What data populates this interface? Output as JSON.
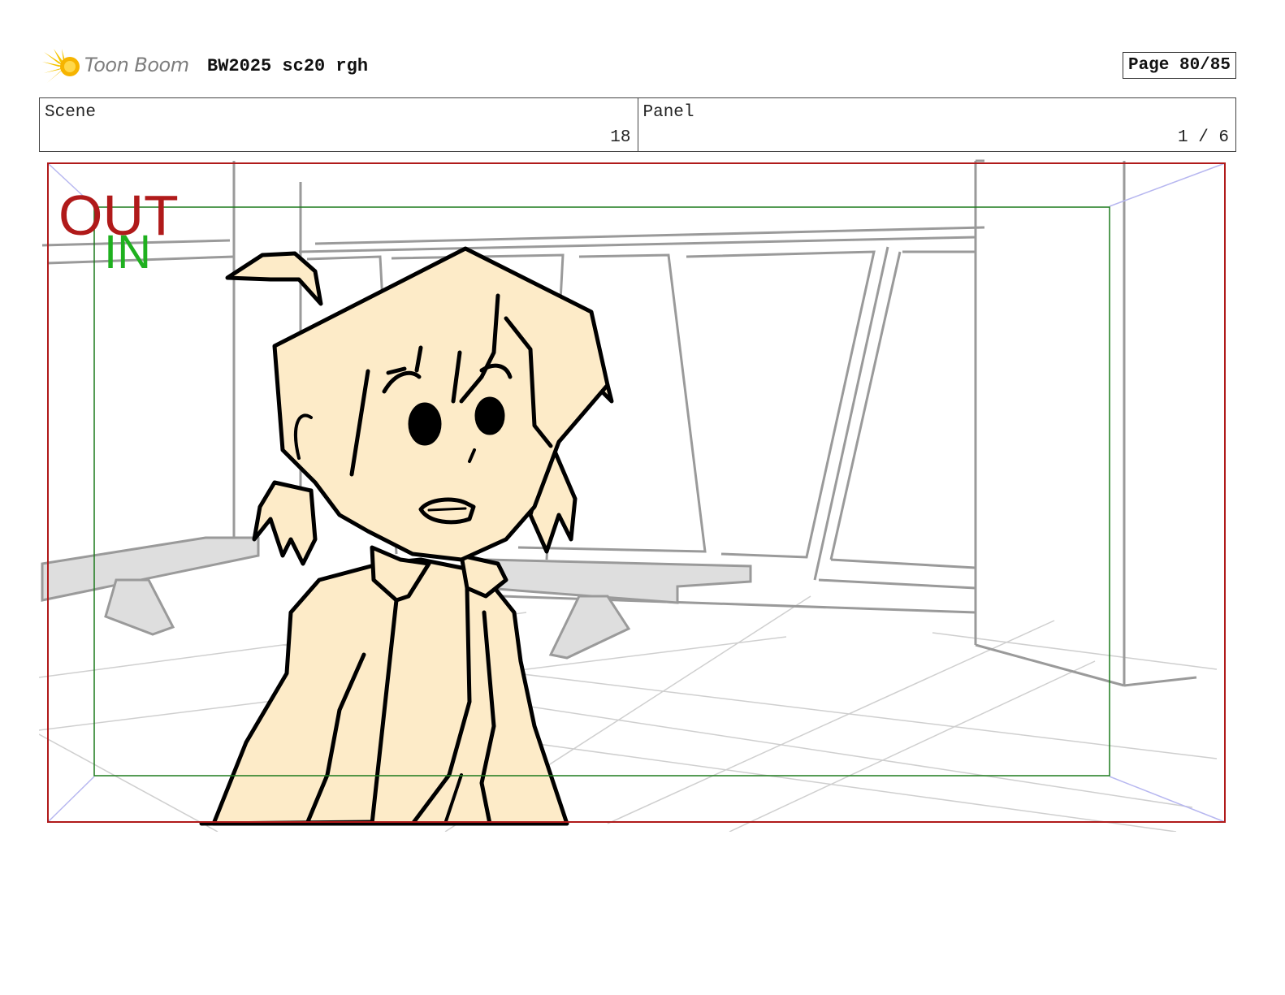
{
  "header": {
    "logo_text": "Toon Boom",
    "doc_title": "BW2025 sc20 rgh",
    "page_label": "Page 80/85"
  },
  "info": {
    "scene_label": "Scene",
    "scene_value": "18",
    "panel_label": "Panel",
    "panel_value": "1 / 6"
  },
  "frame": {
    "out_label": "OUT",
    "in_label": "IN",
    "colors": {
      "out_frame": "#b01a1a",
      "in_frame": "#1c7a1c",
      "in_text": "#1fb01f",
      "skin": "#fdebc8",
      "bg_lines": "#9a9a9a",
      "bench_fill": "#dedede"
    }
  }
}
